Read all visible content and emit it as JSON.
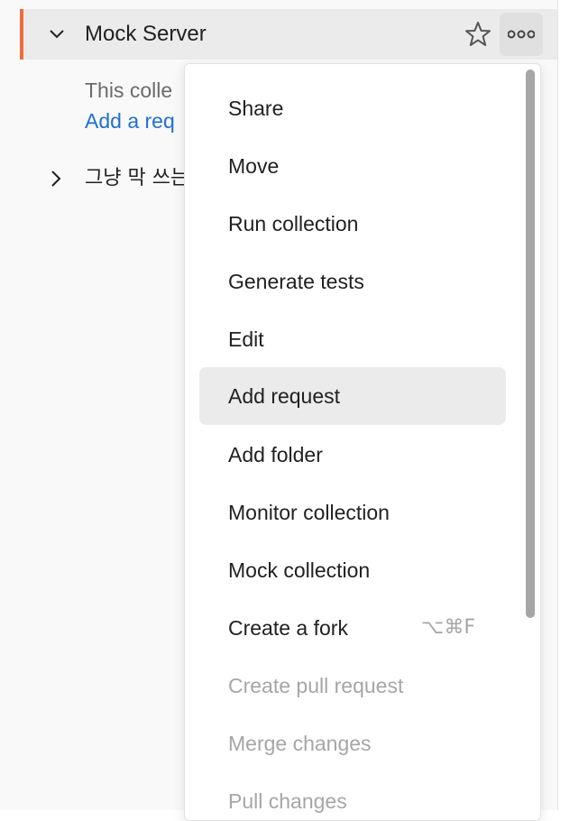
{
  "sidebar": {
    "collection": {
      "name": "Mock Server",
      "empty_text": "This colle",
      "add_request_link": "Add a req"
    },
    "collection2": {
      "name": "그냥 막 쓰는"
    },
    "accent_color": "#f26b3a",
    "link_color": "#1f6fd1"
  },
  "menu": {
    "items": [
      {
        "label": "Share",
        "state": "enabled"
      },
      {
        "label": "Move",
        "state": "enabled"
      },
      {
        "label": "Run collection",
        "state": "enabled"
      },
      {
        "label": "Generate tests",
        "state": "enabled"
      },
      {
        "label": "Edit",
        "state": "enabled"
      },
      {
        "label": "Add request",
        "state": "hover"
      },
      {
        "label": "Add folder",
        "state": "enabled"
      },
      {
        "label": "Monitor collection",
        "state": "enabled"
      },
      {
        "label": "Mock collection",
        "state": "enabled"
      },
      {
        "label": "Create a fork",
        "state": "enabled",
        "shortcut": "⌥⌘F"
      },
      {
        "label": "Create pull request",
        "state": "disabled"
      },
      {
        "label": "Merge changes",
        "state": "disabled"
      },
      {
        "label": "Pull changes",
        "state": "disabled"
      }
    ]
  },
  "icons": {
    "chevron_down": "chevron-down-icon",
    "chevron_right": "chevron-right-icon",
    "star": "star-icon",
    "more": "more-horizontal-icon"
  }
}
